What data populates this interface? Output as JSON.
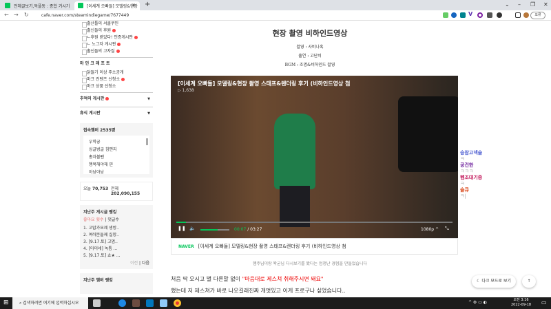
{
  "browser": {
    "tabs": [
      {
        "title": "전체글보기,독플동 : 종합 거시기"
      },
      {
        "title": "[이세계 오빠들] 모델링&현장"
      }
    ],
    "url": "cafe.naver.com/steamindiegame/7677449",
    "profile_label": "오류"
  },
  "sidebar": {
    "items_top": [
      "출산틀의 서클쿠인",
      "출신들의 후원",
      "ㄴ후원 받았다! 인증게시판",
      "ㄴ 노그자 게시판",
      "출신들의 고자질"
    ],
    "section_minecraft": "마 인 크 래 프 트",
    "items_mc": [
      "닭들기 이상 주소공개",
      "마크 컨텐츠 신청소",
      "마크 상품 신청소"
    ],
    "memories": "추억의 게시판",
    "rest": "휴식 게시판",
    "online_title": "접속멤버 2535명",
    "online_members": [
      "우학궁",
      "싱글벙글 침편지",
      "총차볼펜",
      "행복해야해 핀",
      "아낭아낭"
    ],
    "today_label": "오늘",
    "today": "70,753",
    "total_label": "전체",
    "total": "202,090,155",
    "ranking_title": "지난주 게시글 랭킹",
    "rank_tab_likes": "좋아요 횟수",
    "rank_tab_comments": "댓글수",
    "rankings": [
      "1. 고맙가요제 생방..",
      "2. 여러분들께 실망..",
      "3. [9.17.토] 고멉..",
      "4. [아이네] 녹틈 ...",
      "5. [9.17.토] 쇼★ ..."
    ],
    "prev": "이전",
    "next": "다음",
    "member_ranking_title": "지난주 멤버 랭킹"
  },
  "post": {
    "heading": "현장 촬영 비하인드영상",
    "credits": [
      "촬영 : 사비나혹",
      "출연 : 고단비",
      "BGM : 조명&비하인드 촬영"
    ],
    "video": {
      "title": "[이세계 오빠들] 모델링&현장 촬영 스태프&렌더링 후기 (비하인드영상 첨",
      "views": "1,638",
      "current": "00:07",
      "duration": "03:27",
      "quality": "1080p",
      "progress": 0.034,
      "volume": 0.6
    },
    "caption_brand": "NAVER",
    "caption_title": "[이세계 오빠들] 모델링&현장 촬영 스태프&렌더링 후기 (비하인드영상 첨",
    "note": "햄주님이랑 왁굳님 다시보기를 봤다는 엄청난 경험을 만들었습니다",
    "line1_a": "처음 딱 오시고 별 다른말 없이 ",
    "line1_b": "\"마음대로 제스쳐 취해주시면 돼요\"",
    "line2": "했는데 저 제스쳐가 바로 나오길래진짜 개멋있고 이게 프로구나 싶었습니다.."
  },
  "chat": [
    {
      "name": "숭참고넥슬",
      "msg": "ㅋ",
      "color": "#4a5bd0"
    },
    {
      "name": "공건한",
      "msg": "ㅋㅋㅋ",
      "color": "#6a1b9a"
    },
    {
      "name": "헴조대기중",
      "msg": "ㅋ",
      "color": "#c2185b"
    },
    {
      "name": "슬큐",
      "msg": "ㅋ|",
      "color": "#d84315"
    }
  ],
  "dark_mode": "다크 모드로 보기",
  "top_btn": "↑",
  "taskbar": {
    "search": "검색하려면 여기에 입력하십시오",
    "time": "오전 3:16",
    "date": "2022-09-18"
  }
}
